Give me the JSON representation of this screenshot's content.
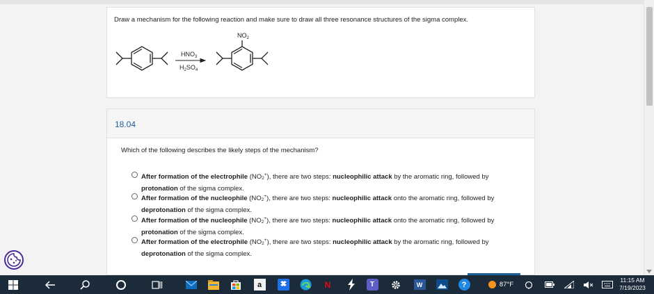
{
  "question_card": {
    "instruction": "Draw a mechanism for the following reaction and make sure to draw all three resonance structures of the sigma complex.",
    "reaction": {
      "reagent_top_main": "HNO",
      "reagent_top_sub": "3",
      "reagent_bottom_a": "H",
      "reagent_bottom_sub1": "2",
      "reagent_bottom_b": "SO",
      "reagent_bottom_sub2": "4",
      "product_label_main": "NO",
      "product_label_sub": "2"
    }
  },
  "question": {
    "number": "18.04",
    "prompt": "Which of the following describes the likely steps of the mechanism?",
    "options": [
      {
        "part1": "After formation of the electrophile (NO",
        "sub": "2",
        "sup": "+",
        "part2": "), there are two steps: nucleophilic attack by the aromatic ring, followed by",
        "line2": "protonation of the sigma complex."
      },
      {
        "part1": "After formation of the nucleophile (NO",
        "sub": "2",
        "sup": "+",
        "part2": "), there are two steps: nucleophilic attack onto the aromatic ring, followed by",
        "line2": "deprotonation of the sigma complex."
      },
      {
        "part1": "After formation of the nucleophile (NO",
        "sub": "2",
        "sup": "+",
        "part2": "), there are two steps: nucleophilic attack onto the aromatic ring, followed by",
        "line2": "protonation of the sigma complex."
      },
      {
        "part1": "After formation of the electrophile (NO",
        "sub": "2",
        "sup": "+",
        "part2": "), there are two steps: nucleophilic attack by the aromatic ring, followed by",
        "line2": "deprotonation of the sigma complex."
      }
    ]
  },
  "taskbar": {
    "weather": "87°F",
    "time": "11:15 AM",
    "date": "7/19/2023",
    "netflix_letter": "N",
    "amazon_letter": "a",
    "teams_letter": "T",
    "word_letter": "W",
    "help_glyph": "?",
    "icons": [
      "windows-start-icon",
      "back-arrow-icon",
      "search-icon",
      "cortana-icon",
      "task-view-icon",
      "mail-icon",
      "file-explorer-icon",
      "store-icon",
      "amazon-icon",
      "dropbox-icon",
      "edge-icon",
      "netflix-icon",
      "bolt-icon",
      "teams-icon",
      "settings-icon",
      "word-icon",
      "photos-icon",
      "help-icon",
      "weather-icon",
      "chevron-up-icon",
      "battery-icon",
      "wifi-icon",
      "volume-icon",
      "keyboard-icon"
    ],
    "accent_color": "#1c2b39"
  },
  "colors": {
    "question_number": "#1f5f9a",
    "cookie_button": "#4a2a96"
  }
}
